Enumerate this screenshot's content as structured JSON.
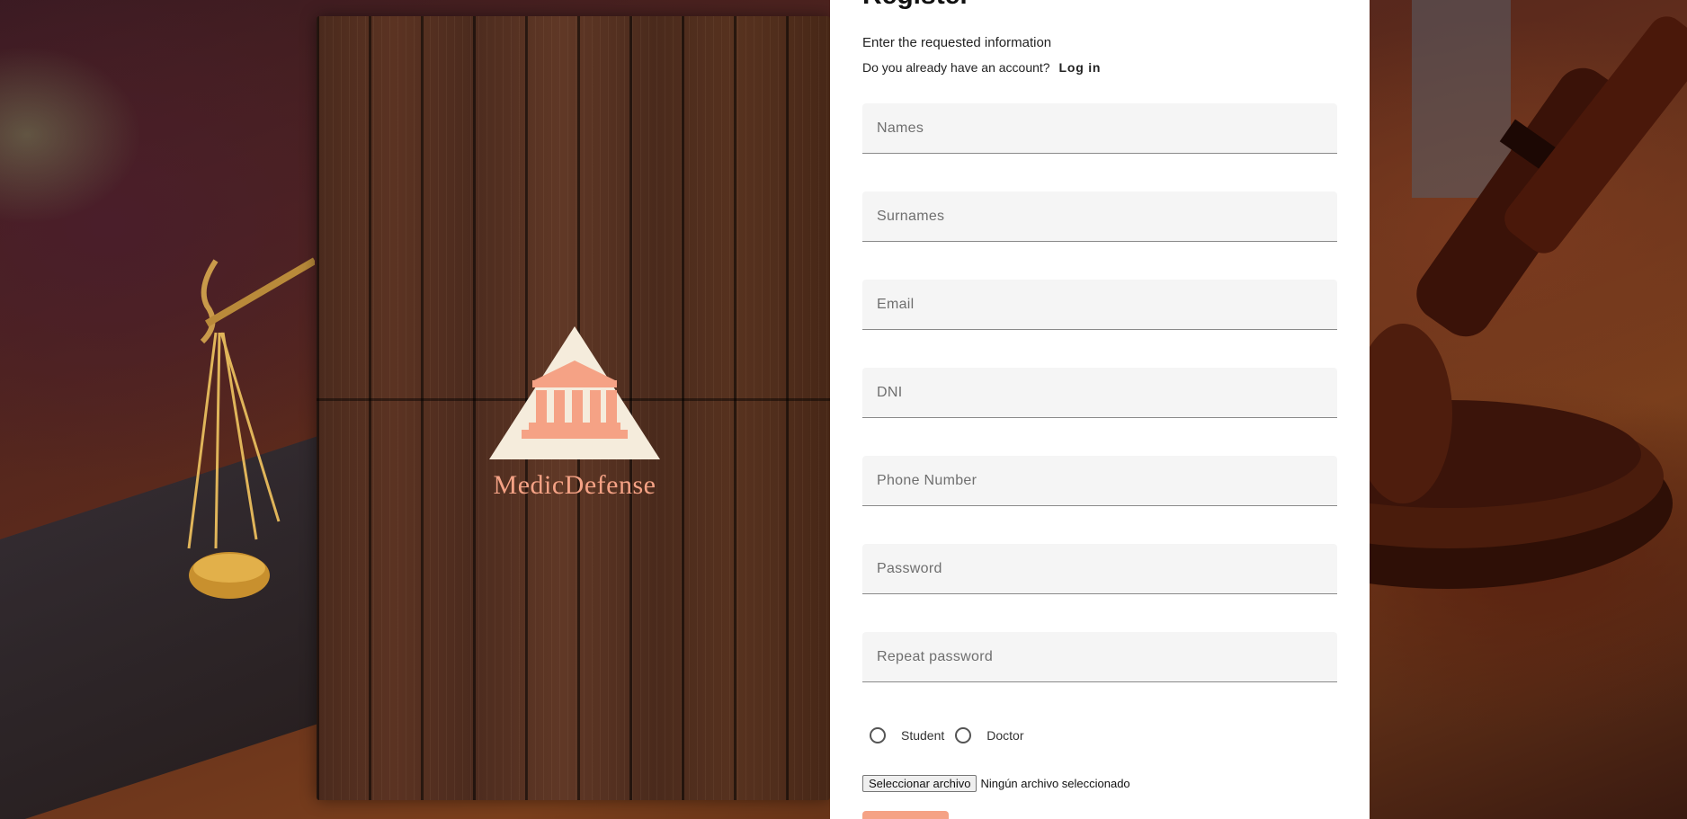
{
  "brand": {
    "name": "MedicDefense",
    "logo_icon": "courthouse-triangle-icon",
    "accent_color": "#f5a285",
    "logo_bg_color": "#f5ecdc"
  },
  "form": {
    "title": "Register",
    "subtitle": "Enter the requested information",
    "account_prompt": "Do you already have an account?",
    "login_link": "Log in",
    "fields": {
      "names": {
        "placeholder": "Names",
        "value": ""
      },
      "surnames": {
        "placeholder": "Surnames",
        "value": ""
      },
      "email": {
        "placeholder": "Email",
        "value": ""
      },
      "dni": {
        "placeholder": "DNI",
        "value": ""
      },
      "phone": {
        "placeholder": "Phone Number",
        "value": ""
      },
      "password": {
        "placeholder": "Password",
        "value": ""
      },
      "repeat_password": {
        "placeholder": "Repeat password",
        "value": ""
      }
    },
    "roles": {
      "student": "Student",
      "doctor": "Doctor",
      "selected": null
    },
    "file": {
      "button_label": "Seleccionar archivo",
      "status": "Ningún archivo seleccionado"
    }
  }
}
